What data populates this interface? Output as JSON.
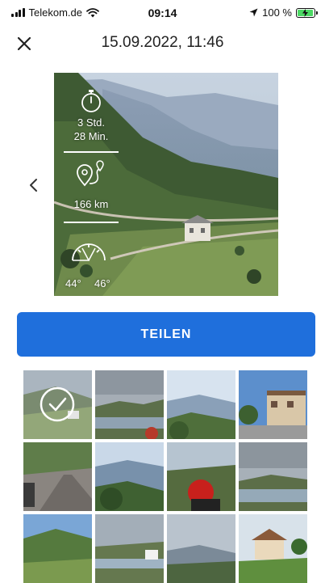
{
  "status_bar": {
    "carrier": "Telekom.de",
    "time": "09:14",
    "battery": "100 %",
    "icons": [
      "signal-icon",
      "wifi-icon",
      "location-arrow-icon",
      "battery-charging-icon"
    ]
  },
  "nav": {
    "title": "15.09.2022, 11:46",
    "close_icon": "close-icon"
  },
  "photo_card": {
    "duration_line1": "3 Std.",
    "duration_line2": "28 Min.",
    "distance": "166 km",
    "angle_left": "44°",
    "angle_right": "46°",
    "icons": [
      "stopwatch-icon",
      "route-pin-icon",
      "lean-angle-gauge-icon"
    ]
  },
  "share_button": {
    "label": "TEILEN"
  },
  "thumbnails": [
    {
      "selected": true
    },
    {
      "selected": false
    },
    {
      "selected": false
    },
    {
      "selected": false
    },
    {
      "selected": false
    },
    {
      "selected": false
    },
    {
      "selected": false
    },
    {
      "selected": false
    },
    {
      "selected": false
    },
    {
      "selected": false
    },
    {
      "selected": false
    },
    {
      "selected": false
    }
  ],
  "colors": {
    "accent": "#1f6fdc",
    "battery": "#4cd964"
  }
}
